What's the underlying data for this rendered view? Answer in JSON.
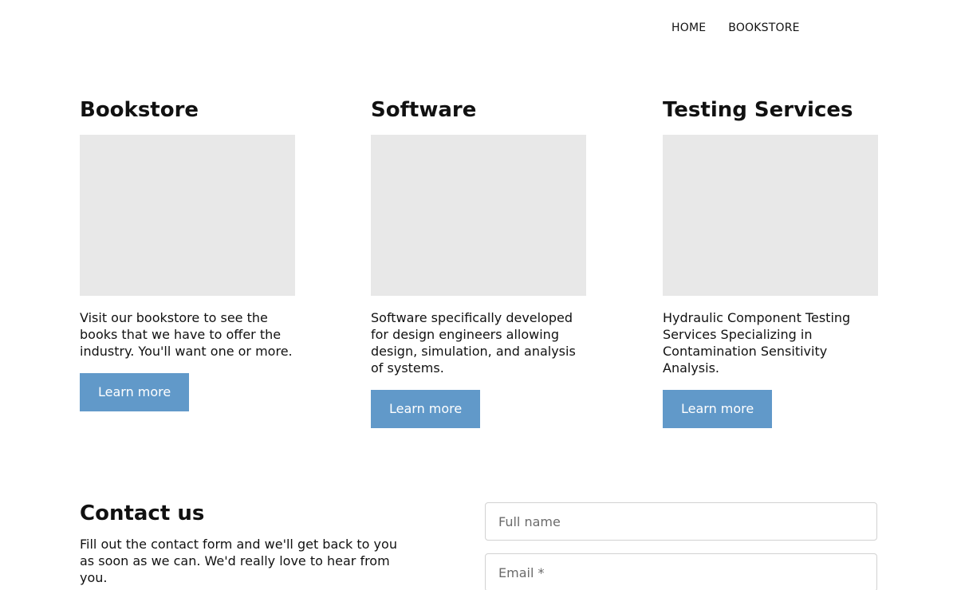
{
  "nav": {
    "items": [
      {
        "label": "HOME"
      },
      {
        "label": "BOOKSTORE"
      }
    ]
  },
  "cards": [
    {
      "title": "Bookstore",
      "text": "Visit our bookstore to see the books that we have to offer the industry. You'll want one or more.",
      "button": "Learn more"
    },
    {
      "title": "Software",
      "text": "Software specifically developed for design engineers allowing design, simulation, and analysis of systems.",
      "button": "Learn more"
    },
    {
      "title": "Testing Services",
      "text": "Hydraulic Component Testing Services Specializing in Contamination Sensitivity Analysis.",
      "button": "Learn more"
    }
  ],
  "contact": {
    "title": "Contact us",
    "text": "Fill out the contact form and we'll get back to you as soon as we can. We'd really love to hear from you."
  },
  "form": {
    "full_name_placeholder": "Full name",
    "email_placeholder": "Email *"
  },
  "colors": {
    "button": "#6199c9",
    "image_placeholder": "#e8e8e8"
  }
}
